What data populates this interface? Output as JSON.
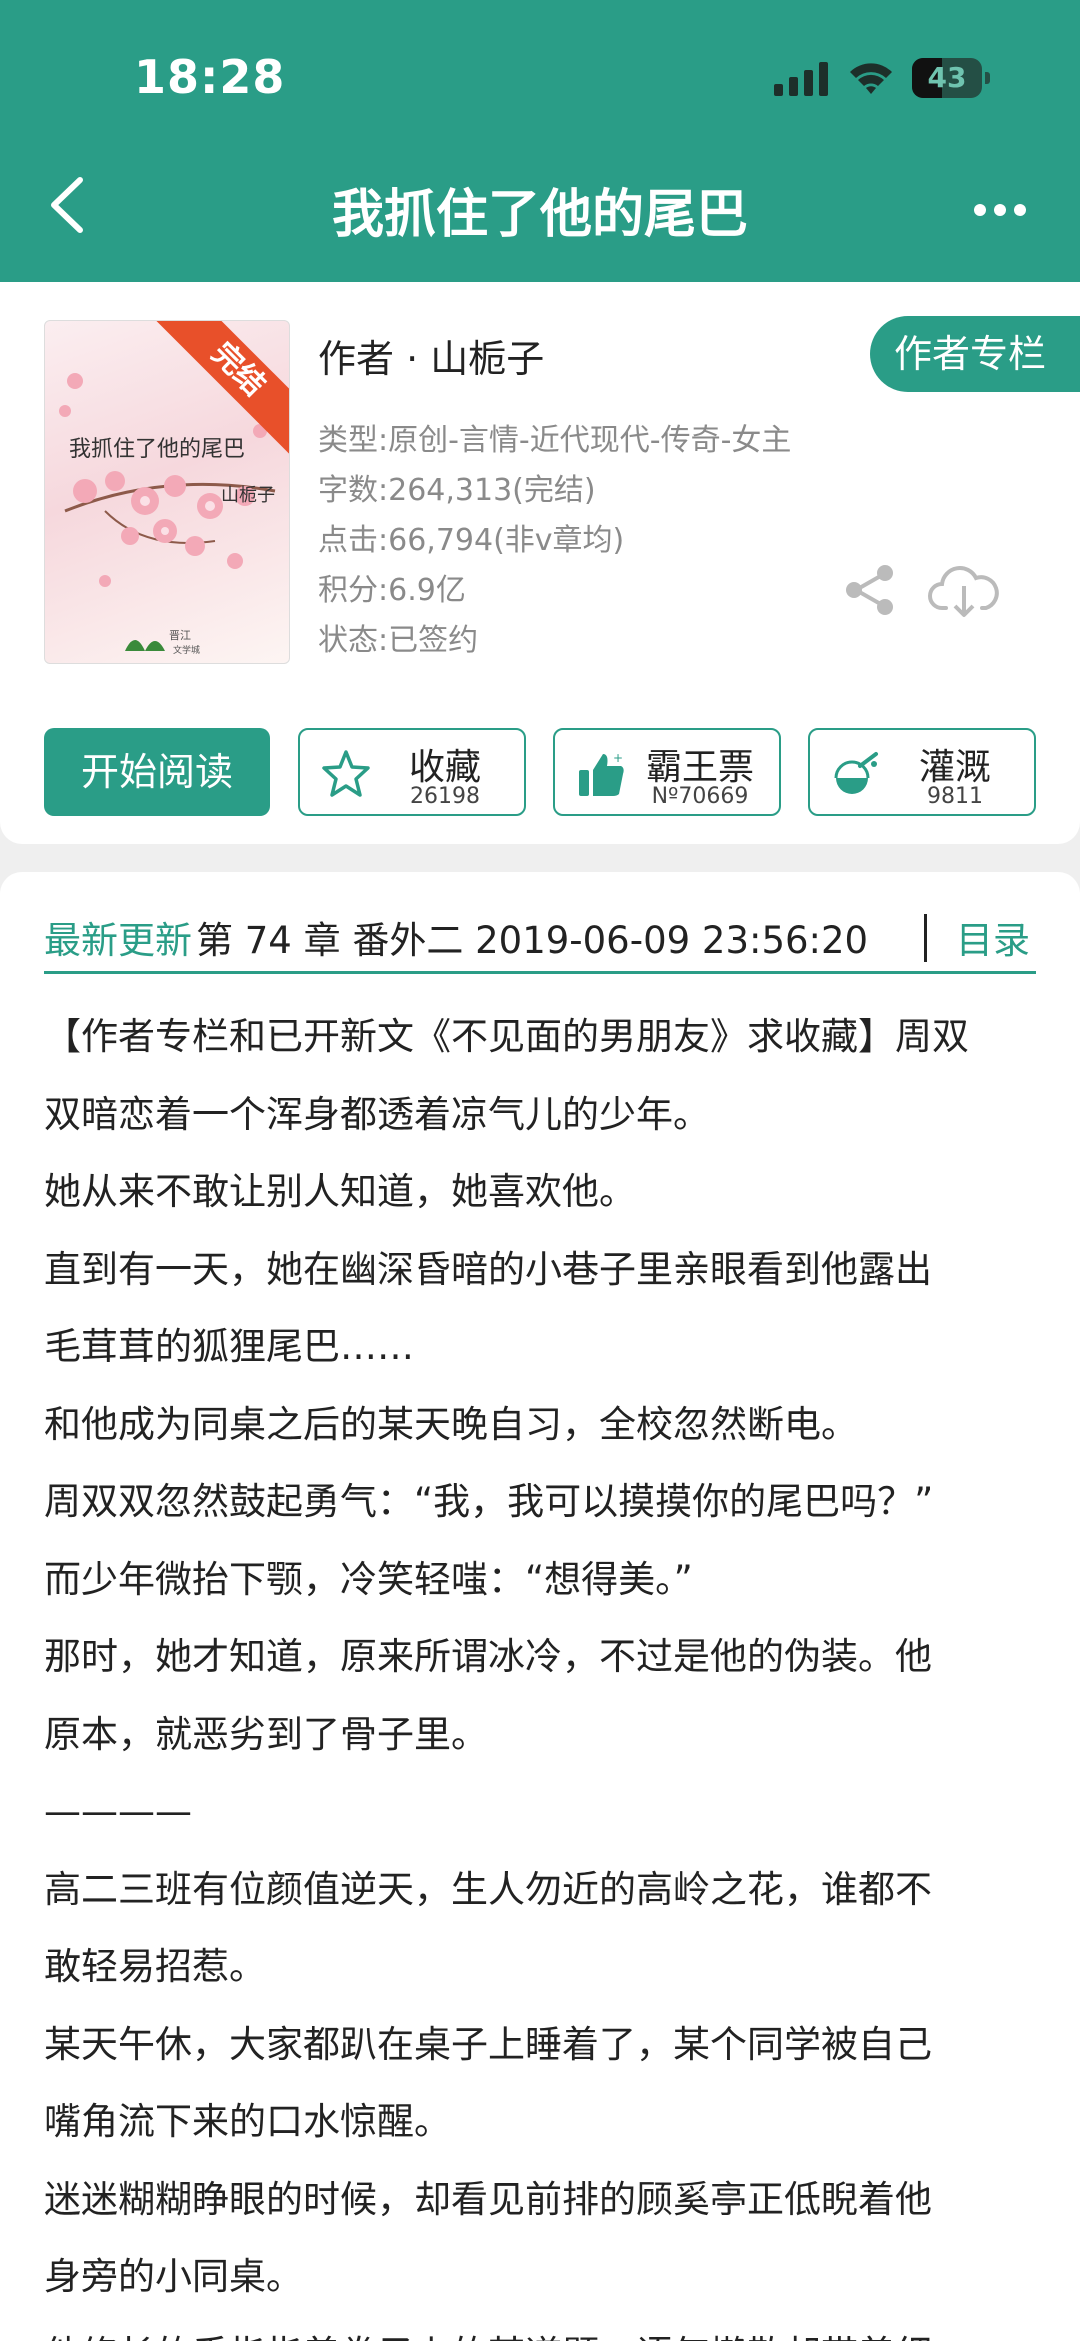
{
  "status_bar": {
    "time": "18:28",
    "battery": "43",
    "battery_level": 0.43
  },
  "nav": {
    "title": "我抓住了他的尾巴"
  },
  "book": {
    "cover": {
      "title": "我抓住了他的尾巴",
      "author": "山栀子",
      "badge": "完结",
      "publisher": "晋江文学城"
    },
    "author_line": "作者 · 山栀子",
    "author_column_label": "作者专栏",
    "meta": [
      "类型:原创-言情-近代现代-传奇-女主",
      "字数:264,313(完结)",
      "点击:66,794(非v章均)",
      "积分:6.9亿",
      "状态:已签约"
    ]
  },
  "actions": {
    "start_reading": "开始阅读",
    "favorite": {
      "label": "收藏",
      "count": "26198"
    },
    "vote": {
      "label": "霸王票",
      "count": "Nº70669"
    },
    "water": {
      "label": "灌溉",
      "count": "9811"
    }
  },
  "latest": {
    "label": "最新更新",
    "text": "第 74 章 番外二 2019-06-09 23:56:20",
    "toc": "目录"
  },
  "intro_lines": [
    "【作者专栏和已开新文《不见面的男朋友》求收藏】周双",
    "双暗恋着一个浑身都透着凉气儿的少年。",
    "她从来不敢让别人知道，她喜欢他。",
    "直到有一天，她在幽深昏暗的小巷子里亲眼看到他露出",
    "毛茸茸的狐狸尾巴……",
    "和他成为同桌之后的某天晚自习，全校忽然断电。",
    "周双双忽然鼓起勇气：“我，我可以摸摸你的尾巴吗？”",
    "而少年微抬下颚，冷笑轻嗤：“想得美。”",
    "那时，她才知道，原来所谓冰冷，不过是他的伪装。他",
    "原本，就恶劣到了骨子里。",
    "————",
    "高二三班有位颜值逆天，生人勿近的高岭之花，谁都不",
    "敢轻易招惹。",
    "某天午休，大家都趴在桌子上睡着了，某个同学被自己",
    "嘴角流下来的口水惊醒。",
    "迷迷糊糊睁眼的时候，却看见前排的顾奚亭正低睨着他",
    "身旁的小同桌。",
    "他修长的手指指着卷子上的某道题，语气懒散却带着细"
  ],
  "colors": {
    "primary": "#2a9d87",
    "ribbon": "#e8502a",
    "meta_text": "#8a8a8a"
  }
}
